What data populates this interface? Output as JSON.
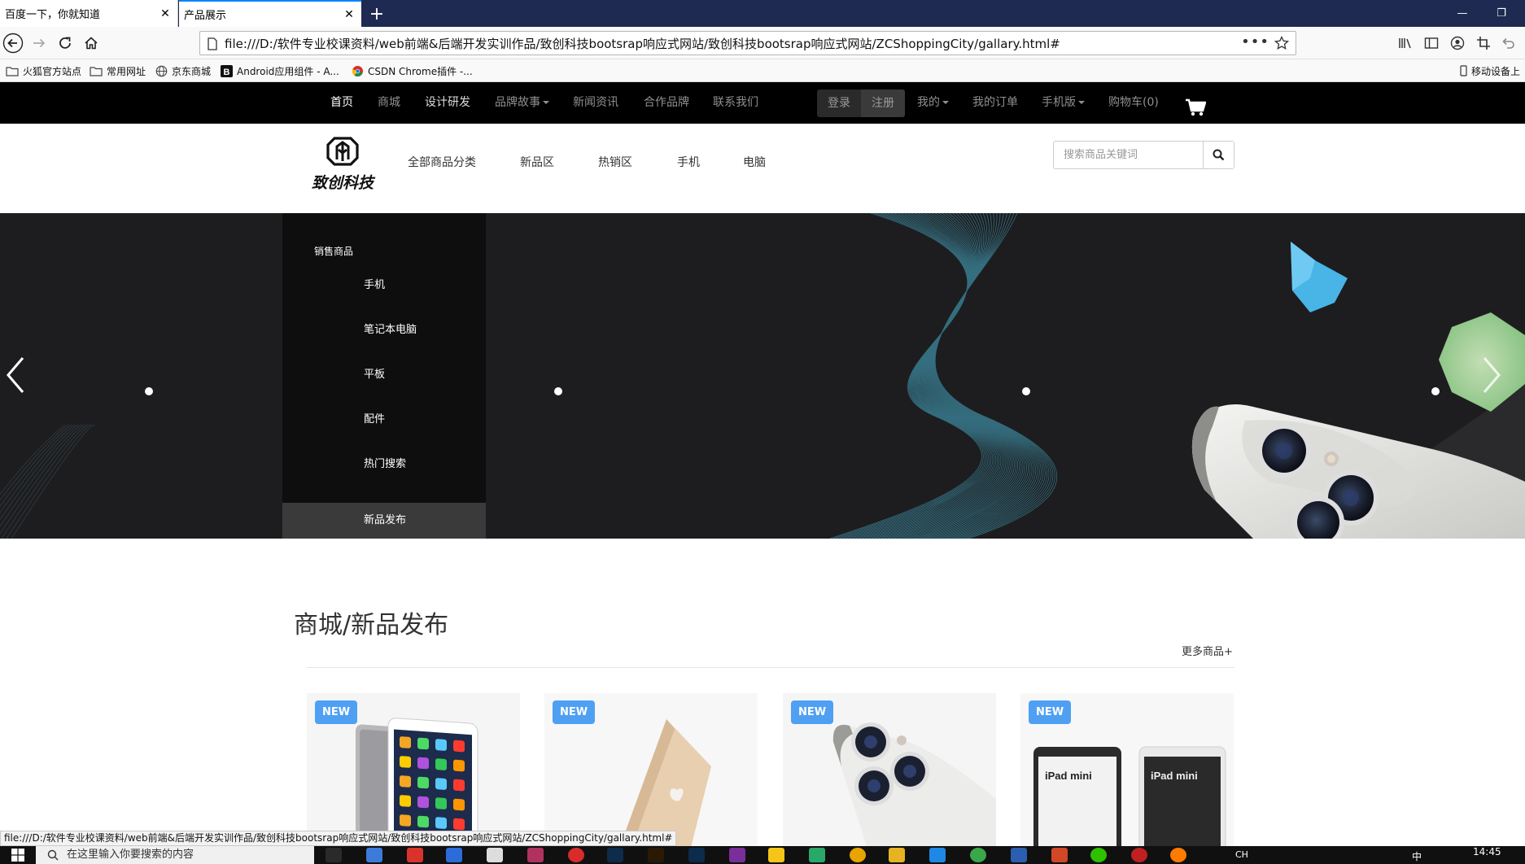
{
  "browser": {
    "tabs": [
      {
        "title": "百度一下，你就知道",
        "active": false
      },
      {
        "title": "产品展示",
        "active": true
      }
    ],
    "url": "file:///D:/软件专业校课资料/web前端&后端开发实训作品/致创科技bootsrap响应式网站/致创科技bootsrap响应式网站/ZCShoppingCity/gallary.html#",
    "url_more": "•••",
    "bookmarks": [
      {
        "label": "火狐官方站点",
        "icon": "folder-icon"
      },
      {
        "label": "常用网址",
        "icon": "folder-icon"
      },
      {
        "label": "京东商城",
        "icon": "globe-icon"
      },
      {
        "label": "Android应用组件 - A...",
        "icon": "b-icon"
      },
      {
        "label": "CSDN Chrome插件 -...",
        "icon": "chrome-icon"
      }
    ],
    "mobile_bookmarks": "移动设备上",
    "status_url": "file:///D:/软件专业校课资料/web前端&后端开发实训作品/致创科技bootsrap响应式网站/致创科技bootsrap响应式网站/ZCShoppingCity/gallary.html#"
  },
  "topnav": {
    "home": "首页",
    "mall": "商城",
    "design": "设计研发",
    "brand_story": "品牌故事",
    "news": "新闻资讯",
    "partners": "合作品牌",
    "contact": "联系我们",
    "login": "登录",
    "register": "注册",
    "mine": "我的",
    "orders": "我的订单",
    "mobile": "手机版",
    "cart": "购物车(0)"
  },
  "header": {
    "logo_text": "致创科技",
    "categories": [
      "全部商品分类",
      "新品区",
      "热销区",
      "手机",
      "电脑"
    ],
    "search_placeholder": "搜索商品关键词"
  },
  "banner": {
    "side_title": "销售商品",
    "side_items": [
      "手机",
      "笔记本电脑",
      "平板",
      "配件",
      "热门搜索",
      "新品发布"
    ],
    "active_item": "新品发布"
  },
  "section": {
    "title": "商城/新品发布",
    "more": "更多商品+",
    "badge": "NEW",
    "ipad_mini_label": "iPad mini"
  },
  "taskbar": {
    "search_placeholder": "在这里输入你要搜索的内容",
    "time": "14:45",
    "lang": "CH",
    "ime": "中"
  },
  "colors": {
    "tab_bar": "#1e2a52",
    "site_top": "#000000",
    "badge": "#4fa0f2",
    "banner_bg": "#1b1b1c",
    "side_menu": "#0e0e0e"
  }
}
